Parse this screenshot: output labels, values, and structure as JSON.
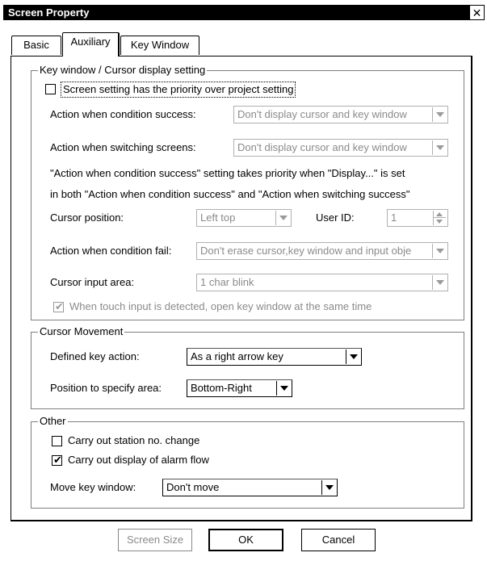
{
  "window": {
    "title": "Screen Property",
    "close_glyph": "✕"
  },
  "tabs": [
    {
      "label": "Basic"
    },
    {
      "label": "Auxiliary"
    },
    {
      "label": "Key Window"
    }
  ],
  "key_window_group": {
    "title": "Key window / Cursor display setting",
    "priority_checkbox": {
      "label": "Screen setting has the priority over project setting",
      "checked": false
    },
    "action_condition_success": {
      "label": "Action when condition success:",
      "value": "Don't display cursor and key window"
    },
    "action_switching": {
      "label": "Action when switching screens:",
      "value": "Don't display cursor and key window"
    },
    "note_line1": "\"Action when condition success\" setting takes priority when \"Display...\" is set",
    "note_line2": "in both \"Action when condition success\" and \"Action when switching success\"",
    "cursor_position": {
      "label": "Cursor position:",
      "value": "Left top"
    },
    "user_id": {
      "label": "User ID:",
      "value": "1"
    },
    "action_condition_fail": {
      "label": "Action when condition fail:",
      "value": "Don't erase cursor,key window and input obje"
    },
    "cursor_input_area": {
      "label": "Cursor input area:",
      "value": "1 char blink"
    },
    "touch_checkbox": {
      "label": "When touch input is detected, open key window at the same time",
      "checked": true
    }
  },
  "cursor_movement_group": {
    "title": "Cursor Movement",
    "defined_key_action": {
      "label": "Defined key action:",
      "value": "As a right arrow key"
    },
    "position_specify_area": {
      "label": "Position to specify area:",
      "value": "Bottom-Right"
    }
  },
  "other_group": {
    "title": "Other",
    "station_change": {
      "label": "Carry out station no. change",
      "checked": false
    },
    "alarm_flow": {
      "label": "Carry out display of alarm flow",
      "checked": true
    },
    "move_key_window": {
      "label": "Move key window:",
      "value": "Don't move"
    }
  },
  "buttons": {
    "screen_size": "Screen Size",
    "ok": "OK",
    "cancel": "Cancel"
  },
  "check_glyph": "✔"
}
